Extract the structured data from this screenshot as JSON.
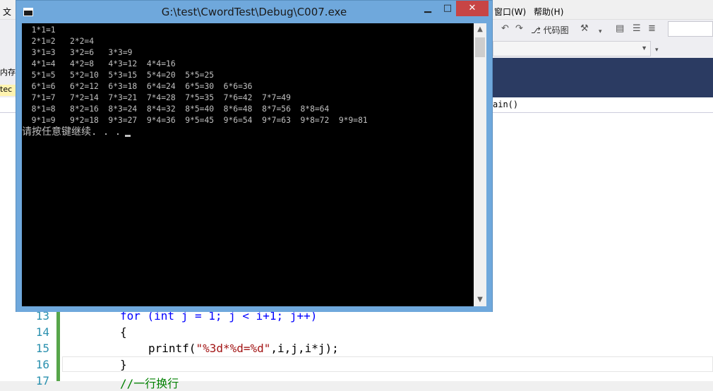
{
  "ide": {
    "menu": {
      "file": "文",
      "window": "窗口(W)",
      "help": "帮助(H)"
    },
    "toolbar": {
      "code_map": "代码图"
    },
    "left_panel": {
      "tab1": "内存",
      "tab2": "tec"
    },
    "nav": {
      "function_label": "ain()"
    },
    "editor": {
      "lines": [
        {
          "no": "13",
          "code": "for (int j = 1; j < i+1; j++)"
        },
        {
          "no": "14",
          "code": "{"
        },
        {
          "no": "15",
          "code_prefix": "printf(",
          "code_string": "\"%3d*%d=%d\"",
          "code_suffix": ",i,j,i*j);"
        },
        {
          "no": "16",
          "code": "}"
        },
        {
          "no": "17",
          "code": "//一行换行"
        }
      ]
    },
    "accent_color": "#2b3b62"
  },
  "console": {
    "title": "G:\\test\\CwordTest\\Debug\\C007.exe",
    "buttons": {
      "minimize": "▁",
      "maximize": "□",
      "close": "✕"
    },
    "output_lines": [
      "  1*1=1",
      "  2*1=2   2*2=4",
      "  3*1=3   3*2=6   3*3=9",
      "  4*1=4   4*2=8   4*3=12  4*4=16",
      "  5*1=5   5*2=10  5*3=15  5*4=20  5*5=25",
      "  6*1=6   6*2=12  6*3=18  6*4=24  6*5=30  6*6=36",
      "  7*1=7   7*2=14  7*3=21  7*4=28  7*5=35  7*6=42  7*7=49",
      "  8*1=8   8*2=16  8*3=24  8*4=32  8*5=40  8*6=48  8*7=56  8*8=64",
      "  9*1=9   9*2=18  9*3=27  9*4=36  9*5=45  9*6=54  9*7=63  9*8=72  9*9=81"
    ],
    "prompt": "请按任意键继续. . .",
    "title_bar_color": "#6fa8dc",
    "close_color": "#c74545"
  }
}
